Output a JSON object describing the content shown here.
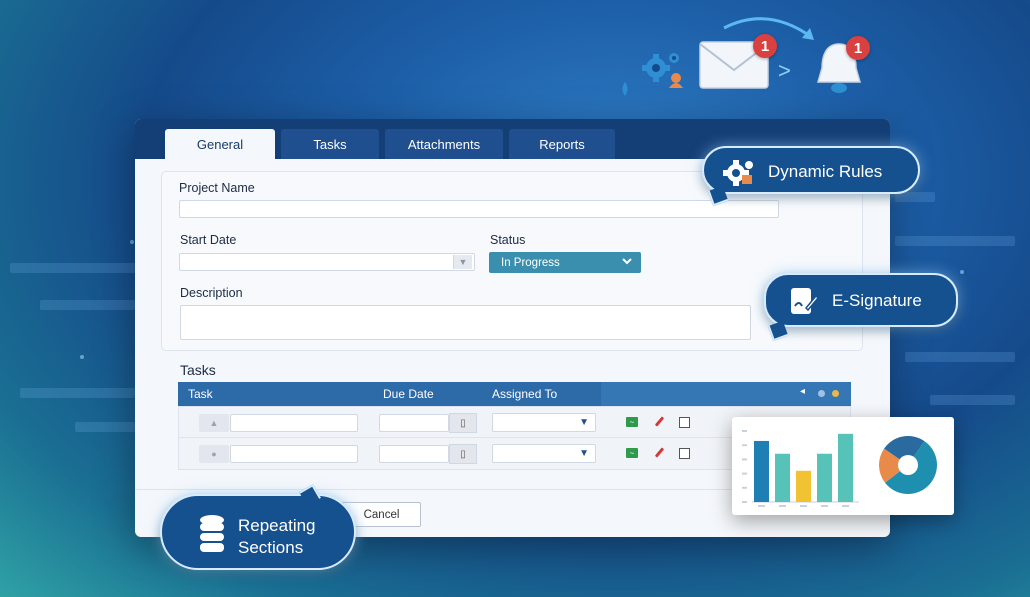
{
  "tabs": [
    {
      "label": "General",
      "active": true
    },
    {
      "label": "Tasks",
      "active": false
    },
    {
      "label": "Attachments",
      "active": false
    },
    {
      "label": "Reports",
      "active": false
    }
  ],
  "form": {
    "project_name_label": "Project Name",
    "project_name_value": "",
    "start_date_label": "Start Date",
    "start_date_value": "",
    "status_label": "Status",
    "status_value": "In Progress",
    "description_label": "Description",
    "description_value": ""
  },
  "tasks_section": {
    "title": "Tasks",
    "columns": [
      "Task",
      "Due Date",
      "Assigned To"
    ],
    "rows": [
      {
        "task": "",
        "due_date": "",
        "assigned_to": ""
      },
      {
        "task": "",
        "due_date": "",
        "assigned_to": ""
      }
    ]
  },
  "buttons": {
    "cancel_label": "Cancel"
  },
  "notifications": {
    "envelope_count": "1",
    "bell_count": "1"
  },
  "callouts": {
    "dynamic_rules": "Dynamic Rules",
    "e_signature": "E-Signature",
    "repeating_sections_line1": "Repeating",
    "repeating_sections_line2": "Sections"
  },
  "colors": {
    "header": "#143e76",
    "accent": "#3a8fae",
    "grid_header": "#2c6aa8",
    "badge": "#d94040"
  },
  "chart_data": {
    "type": "bar",
    "values": [
      43,
      34,
      22,
      34,
      48
    ],
    "ylim": [
      0,
      50
    ],
    "colors": [
      "#1f7fb5",
      "#57c2b7",
      "#f1c232",
      "#57c2b7",
      "#57c2b7"
    ],
    "pie": {
      "type": "pie",
      "values": [
        55,
        20,
        25
      ],
      "colors": [
        "#1f8fb0",
        "#e88b4a",
        "#2a6a9e"
      ]
    }
  }
}
